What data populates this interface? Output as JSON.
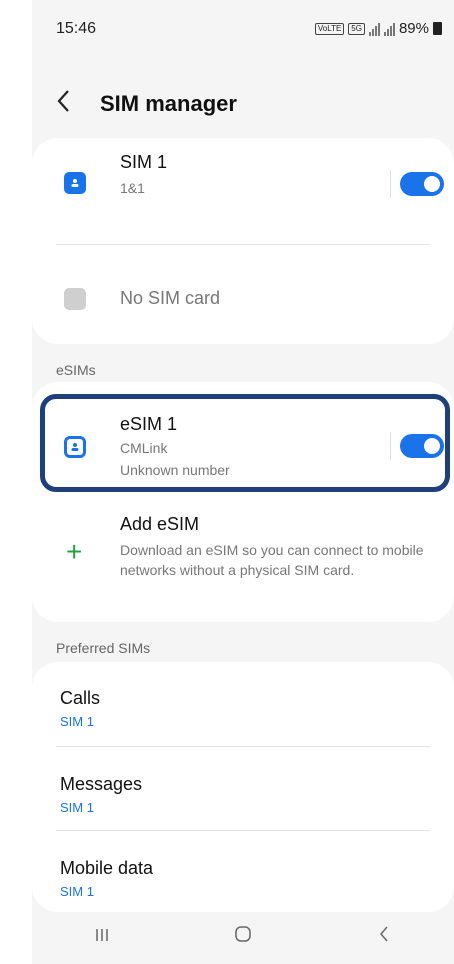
{
  "status_bar": {
    "time": "15:46",
    "volte": "VoLTE",
    "net_5g": "5G",
    "battery": "89%"
  },
  "header": {
    "title": "SIM manager"
  },
  "sims": [
    {
      "name": "SIM 1",
      "carrier": "1&1",
      "enabled": true
    },
    {
      "name": "No SIM card"
    }
  ],
  "esims_section": {
    "label": "eSIMs"
  },
  "esims": [
    {
      "name": "eSIM 1",
      "carrier": "CMLink",
      "number": "Unknown number",
      "enabled": true
    }
  ],
  "add_esim": {
    "title": "Add eSIM",
    "description": "Download an eSIM so you can connect to mobile networks without a physical SIM card."
  },
  "preferred_section": {
    "label": "Preferred SIMs"
  },
  "preferred": [
    {
      "title": "Calls",
      "value": "SIM 1"
    },
    {
      "title": "Messages",
      "value": "SIM 1"
    },
    {
      "title": "Mobile data",
      "value": "SIM 1"
    }
  ],
  "colors": {
    "accent": "#1a73e8",
    "highlight": "#1f3f7a",
    "add": "#2a9d4a"
  },
  "icons": {
    "back": "chevron-left-icon",
    "recent": "recent-apps-icon",
    "home": "home-icon",
    "nav_back": "back-icon"
  }
}
